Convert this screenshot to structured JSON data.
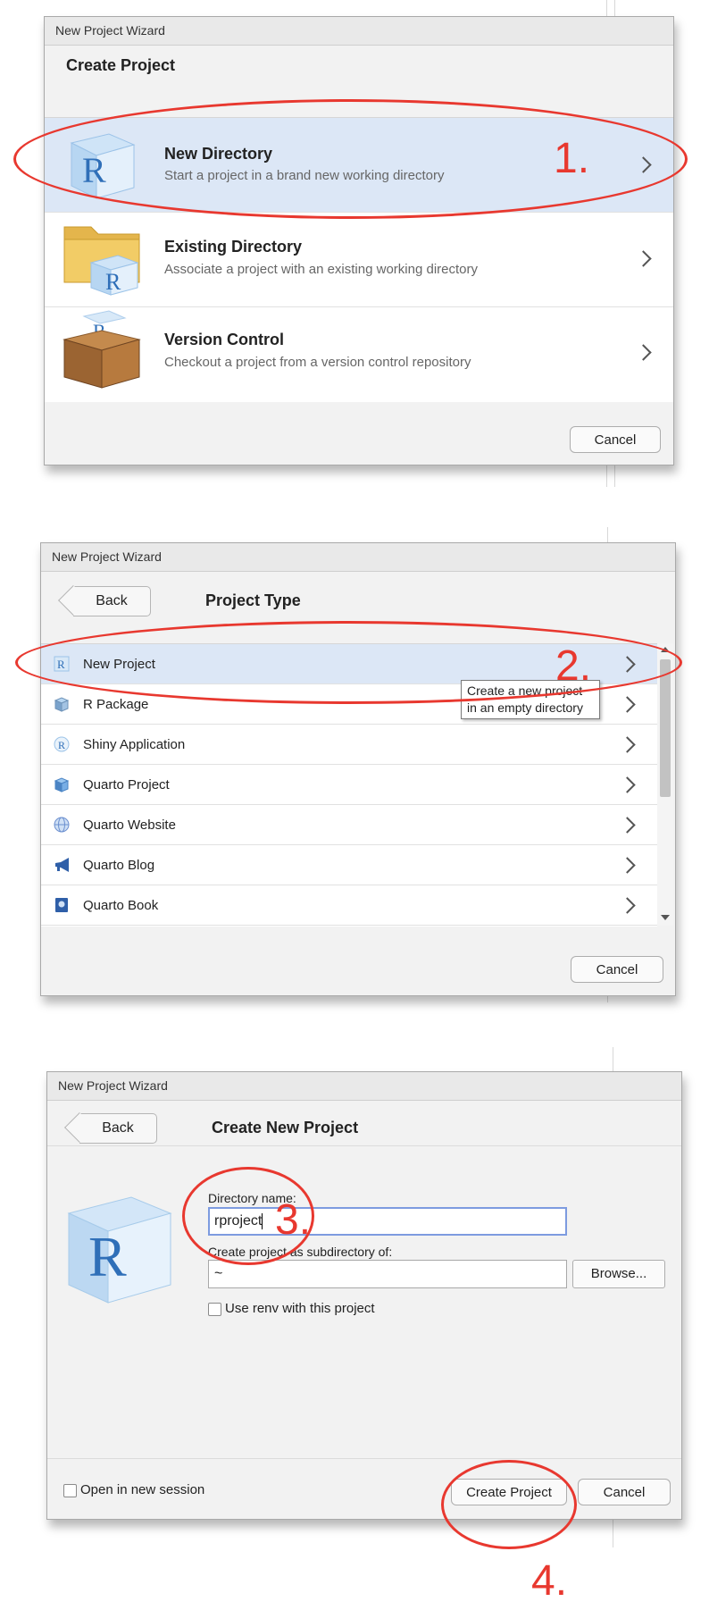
{
  "dialog1": {
    "window_title": "New Project Wizard",
    "heading": "Create Project",
    "options": [
      {
        "title": "New Directory",
        "desc": "Start a project in a brand new working directory"
      },
      {
        "title": "Existing Directory",
        "desc": "Associate a project with an existing working directory"
      },
      {
        "title": "Version Control",
        "desc": "Checkout a project from a version control repository"
      }
    ],
    "cancel_label": "Cancel",
    "step_label": "1."
  },
  "dialog2": {
    "window_title": "New Project Wizard",
    "back_label": "Back",
    "heading": "Project Type",
    "items": [
      {
        "label": "New Project",
        "icon": "r-cube-icon"
      },
      {
        "label": "R Package",
        "icon": "package-icon"
      },
      {
        "label": "Shiny Application",
        "icon": "shiny-icon"
      },
      {
        "label": "Quarto Project",
        "icon": "quarto-project-icon"
      },
      {
        "label": "Quarto Website",
        "icon": "quarto-website-icon"
      },
      {
        "label": "Quarto Blog",
        "icon": "megaphone-icon"
      },
      {
        "label": "Quarto Book",
        "icon": "book-icon"
      }
    ],
    "tooltip": "Create a new project in an empty directory",
    "cancel_label": "Cancel",
    "step_label": "2."
  },
  "dialog3": {
    "window_title": "New Project Wizard",
    "back_label": "Back",
    "heading": "Create New Project",
    "dir_name_label": "Directory name:",
    "dir_name_value": "rproject",
    "subdir_label": "Create project as subdirectory of:",
    "subdir_value": "~",
    "browse_label": "Browse...",
    "renv_label": "Use renv with this project",
    "open_session_label": "Open in new session",
    "create_label": "Create Project",
    "cancel_label": "Cancel",
    "step3_label": "3.",
    "step4_label": "4."
  },
  "colors": {
    "annotation": "#e8382f",
    "selection": "#dce7f6",
    "r_blue": "#2f6fb8"
  }
}
